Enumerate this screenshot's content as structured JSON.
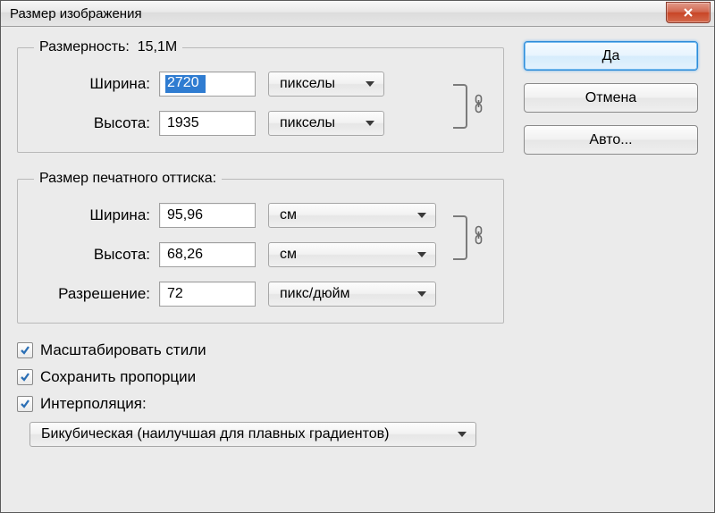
{
  "window": {
    "title": "Размер изображения"
  },
  "group_pixel": {
    "legend_prefix": "Размерность:",
    "legend_value": "15,1M",
    "width_label": "Ширина:",
    "width_value": "2720",
    "width_unit": "пикселы",
    "height_label": "Высота:",
    "height_value": "1935",
    "height_unit": "пикселы"
  },
  "group_print": {
    "legend": "Размер печатного оттиска:",
    "width_label": "Ширина:",
    "width_value": "95,96",
    "width_unit": "см",
    "height_label": "Высота:",
    "height_value": "68,26",
    "height_unit": "см",
    "res_label": "Разрешение:",
    "res_value": "72",
    "res_unit": "пикс/дюйм"
  },
  "checks": {
    "scale_styles": "Масштабировать стили",
    "constrain": "Сохранить пропорции",
    "interp": "Интерполяция:"
  },
  "interp_method": "Бикубическая (наилучшая для плавных градиентов)",
  "buttons": {
    "ok": "Да",
    "cancel": "Отмена",
    "auto": "Авто..."
  }
}
